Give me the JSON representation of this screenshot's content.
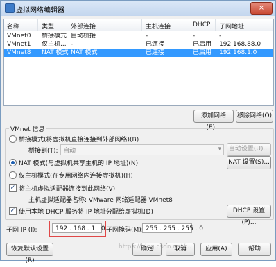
{
  "window": {
    "title": "虚拟网络编辑器",
    "close_label": "×"
  },
  "table": {
    "headers": [
      "名称",
      "类型",
      "外部连接",
      "主机连接",
      "DHCP",
      "子网地址"
    ],
    "rows": [
      [
        "VMnet0",
        "桥接模式",
        "自动桥接",
        "-",
        "-",
        "-"
      ],
      [
        "VMnet1",
        "仅主机...",
        "-",
        "已连接",
        "已启用",
        "192.168.88.0"
      ],
      [
        "VMnet8",
        "NAT 模式",
        "NAT 模式",
        "已连接",
        "已启用",
        "192.168.1.0"
      ]
    ],
    "selected_index": 2
  },
  "buttons": {
    "add_network": "添加网络(E)...",
    "remove_network": "移除网络(O)",
    "auto_settings": "自动设置(U)...",
    "nat_settings": "NAT 设置(S)...",
    "dhcp_settings": "DHCP 设置(P)...",
    "restore_defaults": "恢复默认设置(R)",
    "ok": "确定",
    "cancel": "取消",
    "apply": "应用(A)",
    "help": "帮助"
  },
  "vmnet_info": {
    "legend": "VMnet 信息",
    "bridged_label": "桥接模式(将虚拟机直接连接到外部网络)(B)",
    "bridged_to_label": "桥接到(T):",
    "bridged_to_value": "自动",
    "nat_label": "NAT 模式(与虚拟机共享主机的 IP 地址)(N)",
    "hostonly_label": "仅主机模式(在专用网络内连接虚拟机)(H)",
    "connect_adapter_label": "将主机虚拟适配器连接到此网络(V)",
    "adapter_name_label": "主机虚拟适配器名称: VMware 网络适配器 VMnet8",
    "use_dhcp_label": "使用本地 DHCP 服务将 IP 地址分配给虚拟机(D)",
    "selected_mode": "nat",
    "connect_adapter_checked": true,
    "use_dhcp_checked": true
  },
  "subnet": {
    "ip_label": "子网 IP (I):",
    "ip_value": "192 . 168 . 1  . 0",
    "mask_label": "子网掩码(M):",
    "mask_value": "255 . 255 . 255 . 0"
  },
  "watermark": "https://blog.csdn.net/..."
}
